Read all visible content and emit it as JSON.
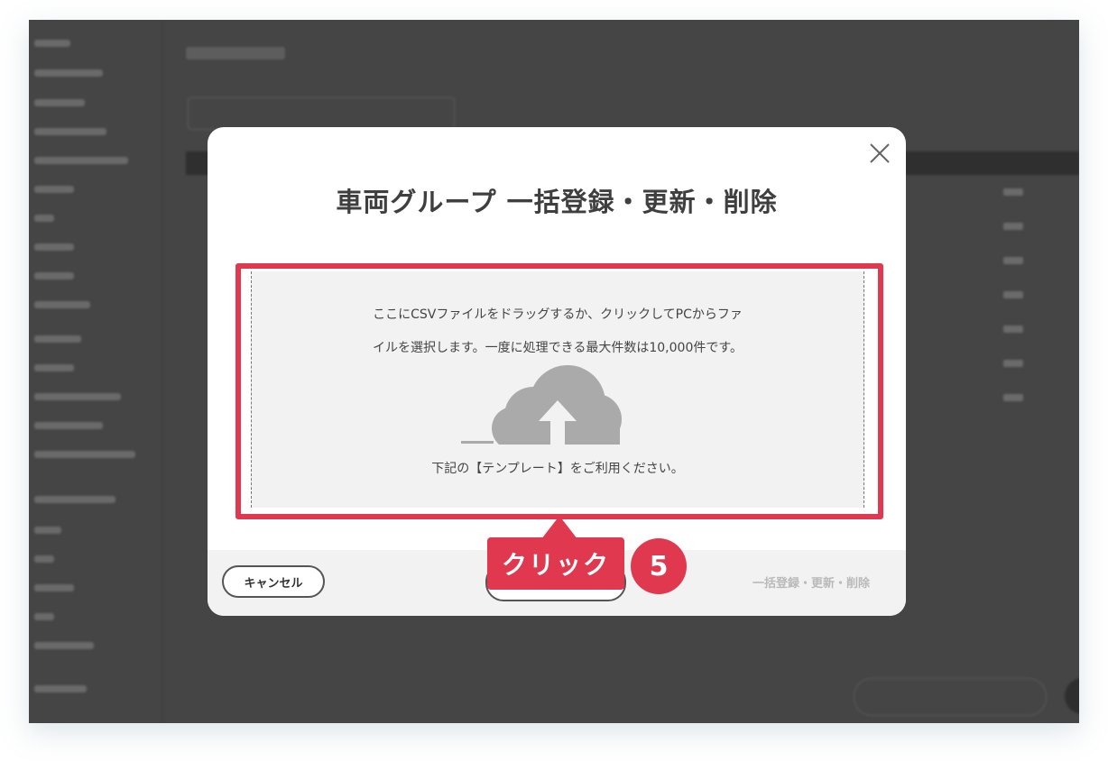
{
  "modal": {
    "title": "車両グループ 一括登録・更新・削除",
    "dropzone": {
      "instruction_line1": "ここにCSVファイルをドラッグするか、クリックしてPCからファ",
      "instruction_line2": "イルを選択します。一度に処理できる最大件数は10,000件です。",
      "template_note": "下記の【テンプレート】をご利用ください。"
    },
    "footer": {
      "cancel_label": "キャンセル",
      "submit_label": "一括登録・更新・削除"
    }
  },
  "annotation": {
    "callout_label": "クリック",
    "step_number": "5"
  },
  "colors": {
    "accent": "#e0384e",
    "overlay": "#454545",
    "dropzone_bg": "#f2f2f2",
    "cloud": "#aaaaaa"
  },
  "icons": {
    "close": "close-icon",
    "upload": "cloud-upload-icon"
  }
}
